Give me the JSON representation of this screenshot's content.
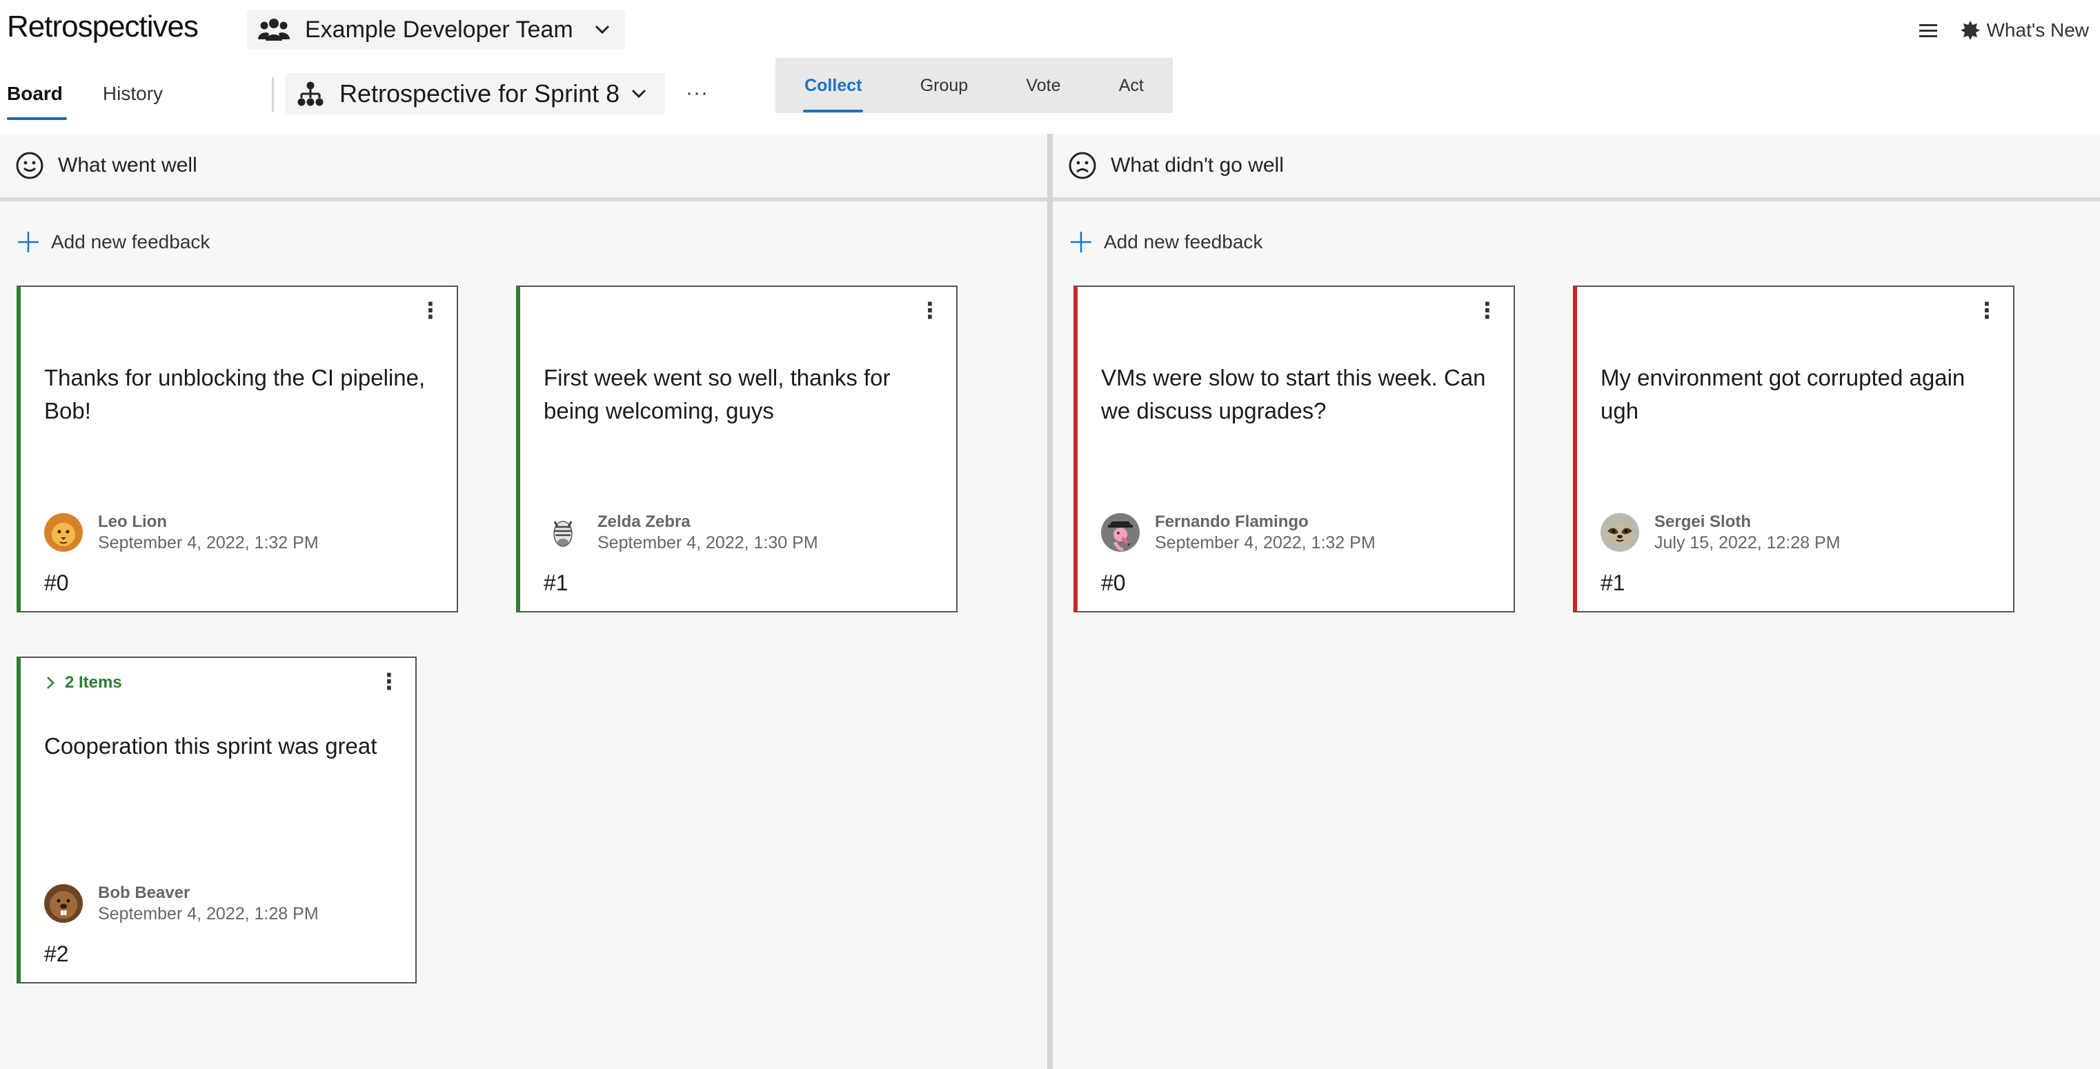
{
  "header": {
    "app_title": "Retrospectives",
    "team_name": "Example Developer Team",
    "whats_new_label": "What's New"
  },
  "nav": {
    "tabs": [
      {
        "label": "Board",
        "active": true
      },
      {
        "label": "History",
        "active": false
      }
    ]
  },
  "board_selector": {
    "name": "Retrospective for Sprint 8"
  },
  "more_label": "···",
  "phases": [
    {
      "label": "Collect",
      "active": true
    },
    {
      "label": "Group",
      "active": false
    },
    {
      "label": "Vote",
      "active": false
    },
    {
      "label": "Act",
      "active": false
    }
  ],
  "columns": [
    {
      "title": "What went well",
      "icon": "smile-icon",
      "add_label": "Add new feedback",
      "accent": "#2e7d32",
      "cards": [
        {
          "text": "Thanks for unblocking the CI pipeline, Bob!",
          "author": "Leo Lion",
          "date": "September 4, 2022, 1:32 PM",
          "number": "#0",
          "avatar": "lion-avatar"
        },
        {
          "text": "First week went so well, thanks for being welcoming, guys",
          "author": "Zelda Zebra",
          "date": "September 4, 2022, 1:30 PM",
          "number": "#1",
          "avatar": "zebra-avatar"
        },
        {
          "group_label": "2 Items",
          "text": "Cooperation this sprint was great",
          "author": "Bob Beaver",
          "date": "September 4, 2022, 1:28 PM",
          "number": "#2",
          "avatar": "beaver-avatar"
        }
      ]
    },
    {
      "title": "What didn't go well",
      "icon": "frown-icon",
      "add_label": "Add new feedback",
      "accent": "#c62828",
      "cards": [
        {
          "text": "VMs were slow to start this week. Can we discuss upgrades?",
          "author": "Fernando Flamingo",
          "date": "September 4, 2022, 1:32 PM",
          "number": "#0",
          "avatar": "flamingo-avatar"
        },
        {
          "text": "My environment got corrupted again ugh",
          "author": "Sergei Sloth",
          "date": "July 15, 2022, 12:28 PM",
          "number": "#1",
          "avatar": "sloth-avatar"
        }
      ]
    }
  ]
}
